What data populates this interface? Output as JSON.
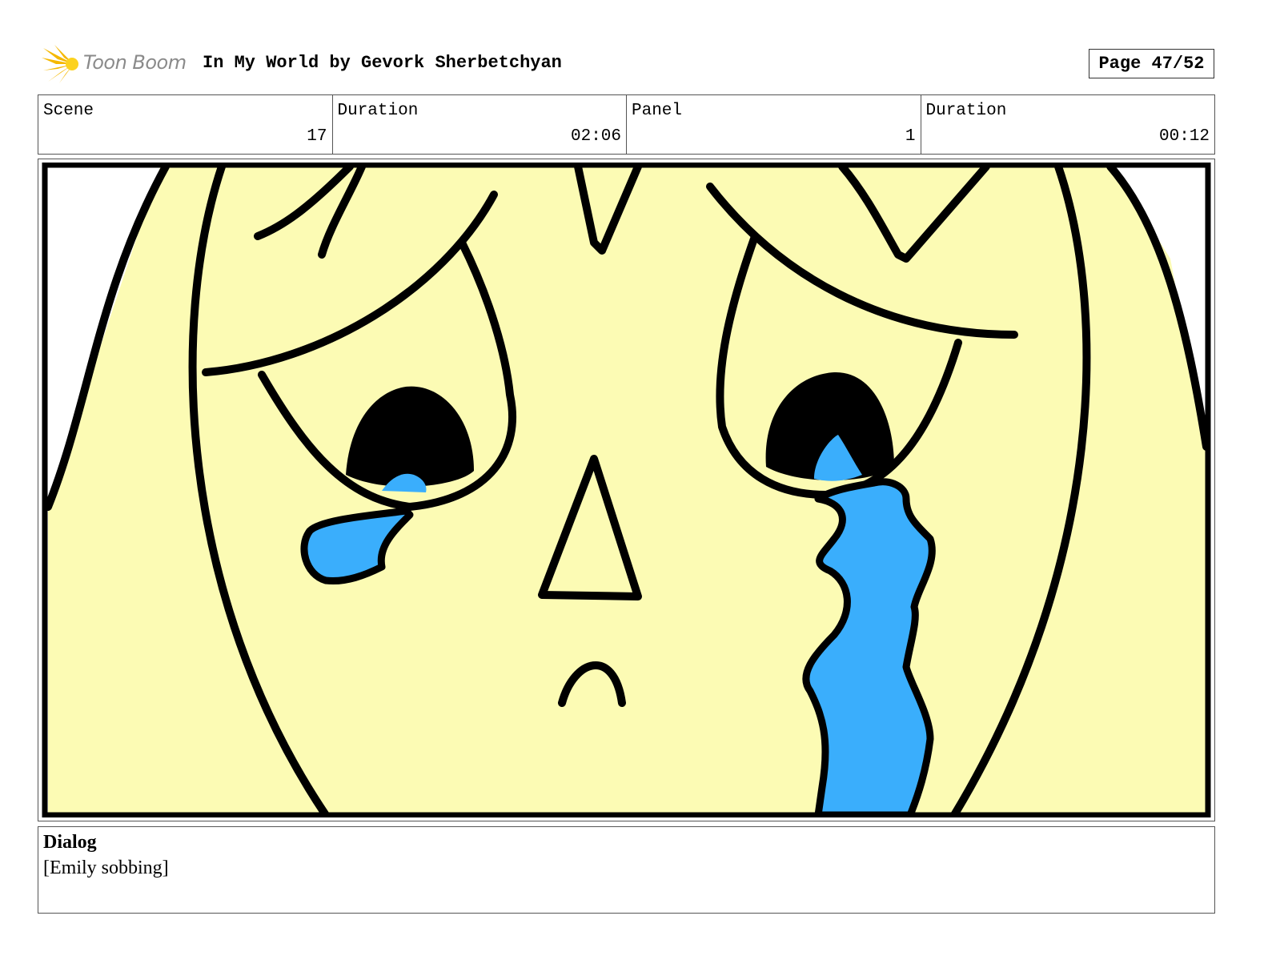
{
  "header": {
    "logo_text": "Toon Boom",
    "title": "In My World by Gevork Sherbetchyan",
    "page": "Page 47/52"
  },
  "info": {
    "scene_label": "Scene",
    "scene_value": "17",
    "scene_duration_label": "Duration",
    "scene_duration_value": "02:06",
    "panel_label": "Panel",
    "panel_value": "1",
    "panel_duration_label": "Duration",
    "panel_duration_value": "00:12"
  },
  "panel": {
    "skin_color": "#fcfbb4",
    "tear_color": "#3aaefc",
    "line_color": "#000000"
  },
  "dialog": {
    "title": "Dialog",
    "text": "[Emily sobbing]"
  }
}
